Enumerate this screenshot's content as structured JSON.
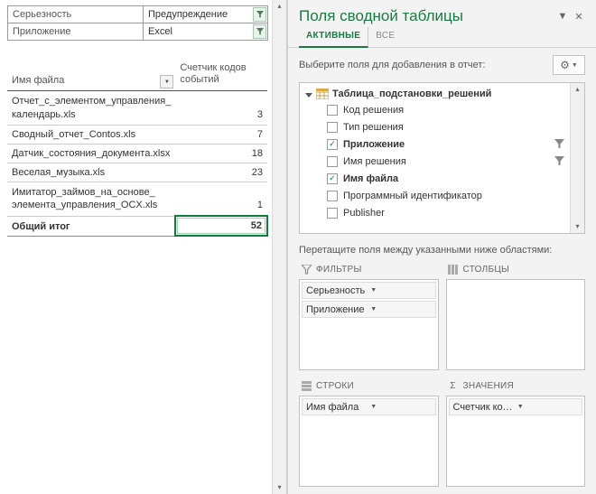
{
  "pivot": {
    "filters": [
      {
        "label": "Серьезность",
        "value": "Предупреждение",
        "has_filter": true
      },
      {
        "label": "Приложение",
        "value": "Excel",
        "has_filter": true
      }
    ],
    "col_file": "Имя файла",
    "col_count": "Счетчик кодов событий",
    "rows": [
      {
        "name": "Отчет_с_элементом_управления_\nкалендарь.xls",
        "count": 3,
        "two_line": true
      },
      {
        "name": "Сводный_отчет_Contos.xls",
        "count": 7,
        "two_line": false
      },
      {
        "name": "Датчик_состояния_документа.xlsx",
        "count": 18,
        "two_line": false
      },
      {
        "name": "Веселая_музыка.xls",
        "count": 23,
        "two_line": false
      },
      {
        "name": "Имитатор_займов_на_основе_\nэлемента_управления_OCX.xls",
        "count": 1,
        "two_line": true
      }
    ],
    "grand_total_label": "Общий итог",
    "grand_total_value": 52
  },
  "pane": {
    "title": "Поля сводной таблицы",
    "tabs": {
      "active": "АКТИВНЫЕ",
      "all": "ВСЕ"
    },
    "instruction": "Выберите поля для добавления в отчет:",
    "table_name": "Таблица_подстановки_решений",
    "fields": [
      {
        "label": "Код решения",
        "checked": false,
        "filter": false
      },
      {
        "label": "Тип решения",
        "checked": false,
        "filter": false
      },
      {
        "label": "Приложение",
        "checked": true,
        "filter": true
      },
      {
        "label": "Имя решения",
        "checked": false,
        "filter": true
      },
      {
        "label": "Имя файла",
        "checked": true,
        "filter": false
      },
      {
        "label": "Программный идентификатор",
        "checked": false,
        "filter": false
      },
      {
        "label": "Publisher",
        "checked": false,
        "filter": false
      }
    ],
    "drag_instruction": "Перетащите поля между указанными ниже областями:",
    "areas": {
      "filters": {
        "title": "ФИЛЬТРЫ",
        "items": [
          "Серьезность",
          "Приложение"
        ]
      },
      "columns": {
        "title": "СТОЛБЦЫ",
        "items": []
      },
      "rows": {
        "title": "СТРОКИ",
        "items": [
          "Имя файла"
        ]
      },
      "values": {
        "title": "ЗНАЧЕНИЯ",
        "items": [
          "Счетчик кодов событий"
        ]
      }
    }
  }
}
